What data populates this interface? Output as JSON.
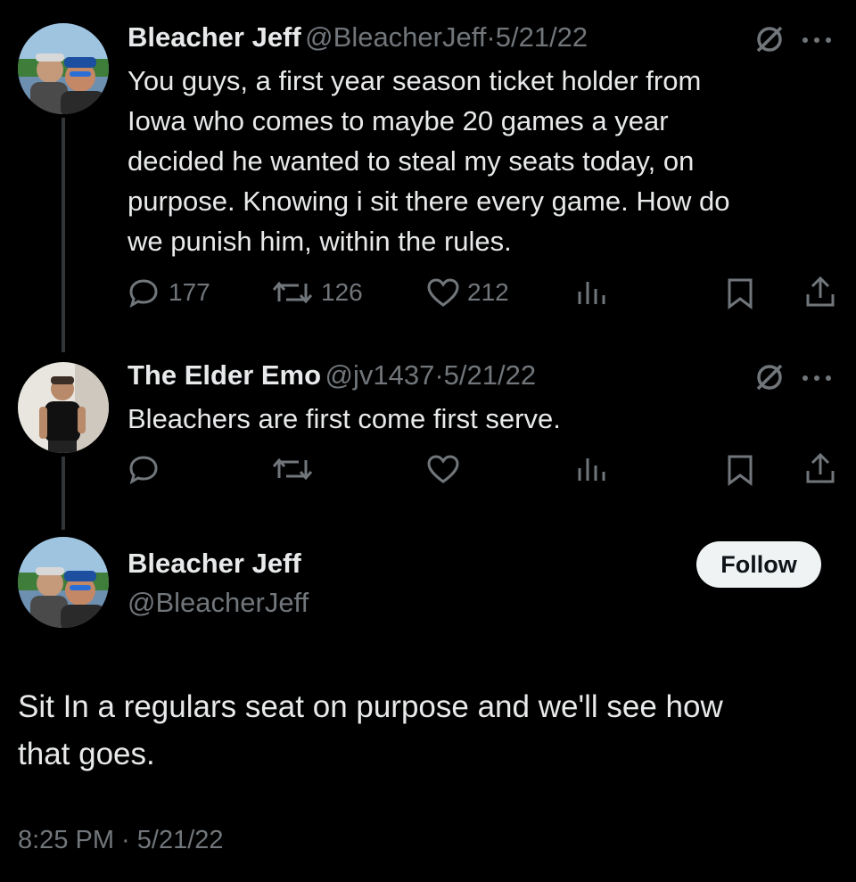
{
  "thread": [
    {
      "author_name": "Bleacher Jeff",
      "handle": "@BleacherJeff",
      "date": "5/21/22",
      "text_lines": [
        "You guys, a first year season ticket holder from",
        "Iowa who comes to maybe 20 games a year",
        "decided he wanted to steal my seats today, on",
        "purpose. Knowing i sit there every game. How do",
        "we punish him, within the rules."
      ],
      "replies": "177",
      "reposts": "126",
      "likes": "212"
    },
    {
      "author_name": "The Elder Emo",
      "handle": "@jv1437",
      "date": "5/21/22",
      "text_lines": [
        "Bleachers are first come first serve."
      ],
      "replies": "",
      "reposts": "",
      "likes": ""
    }
  ],
  "main_tweet": {
    "author_name": "Bleacher Jeff",
    "handle": "@BleacherJeff",
    "follow_label": "Follow",
    "text_lines": [
      "Sit In a regulars seat on purpose and we'll see how",
      "that goes."
    ],
    "timestamp": "8:25 PM · 5/21/22"
  },
  "separator": "·",
  "colors": {
    "background": "#000000",
    "text": "#e7e9ea",
    "muted": "#71767b",
    "thread_line": "#333639",
    "follow_bg": "#eff3f4"
  },
  "icons": [
    "avatar",
    "muted-icon",
    "more-icon",
    "reply-icon",
    "repost-icon",
    "like-icon",
    "analytics-icon",
    "bookmark-icon",
    "share-icon"
  ]
}
